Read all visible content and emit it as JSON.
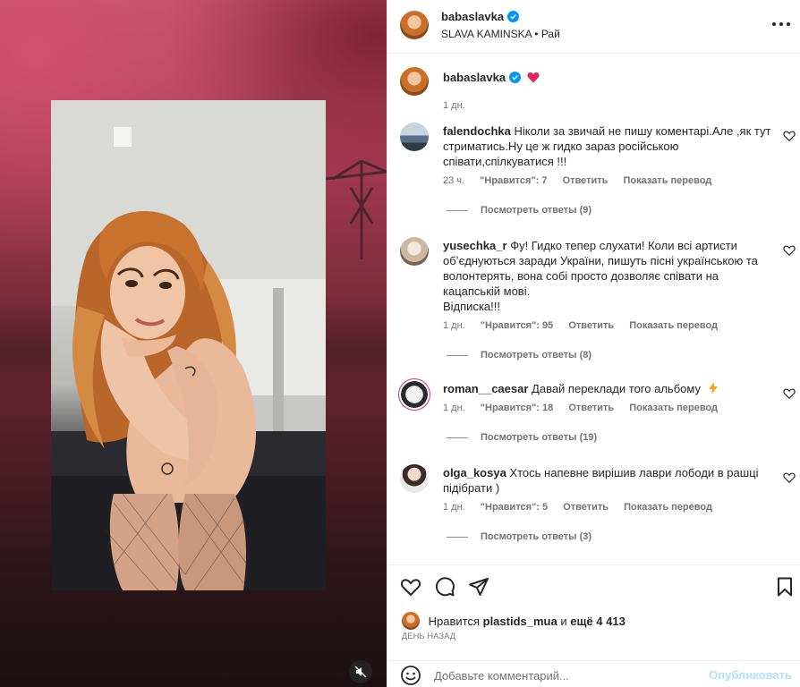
{
  "post_author": {
    "username": "babaslavka",
    "subtitle_name": "SLAVA KAMINSKA",
    "subtitle_separator": "•",
    "subtitle_audio": "Рай"
  },
  "caption": {
    "username": "babaslavka",
    "time": "1 дн."
  },
  "comments": [
    {
      "username": "falendochka",
      "text": "Ніколи за звичай не пишу коментарі.Але ,як тут стриматись.Ну це ж гидко зараз російською співати,спілкуватися !!!",
      "time": "23 ч.",
      "likes": "\"Нравится\": 7",
      "reply": "Ответить",
      "translate": "Показать перевод",
      "view_replies": "Посмотреть ответы (9)"
    },
    {
      "username": "yusechka_r",
      "text": "Фу! Гидко тепер слухати! Коли всі артисти обʼєднуються заради України, пишуть пісні українською та волонтерять, вона собі просто дозволяє співати на кацапській мові.",
      "text_line2": "Відписка!!!",
      "time": "1 дн.",
      "likes": "\"Нравится\": 95",
      "reply": "Ответить",
      "translate": "Показать перевод",
      "view_replies": "Посмотреть ответы (8)"
    },
    {
      "username": "roman__caesar",
      "text": "Давай переклади того альбому",
      "time": "1 дн.",
      "likes": "\"Нравится\": 18",
      "reply": "Ответить",
      "translate": "Показать перевод",
      "view_replies": "Посмотреть ответы (19)"
    },
    {
      "username": "olga_kosya",
      "text": "Хтось напевне вирішив лаври лободи в рашці підібрати )",
      "time": "1 дн.",
      "likes": "\"Нравится\": 5",
      "reply": "Ответить",
      "translate": "Показать перевод",
      "view_replies": "Посмотреть ответы (3)"
    }
  ],
  "likes_line": {
    "prefix": "Нравится",
    "user": "plastids_mua",
    "middle": "и",
    "rest": "ещё 4 413"
  },
  "date": "ДЕНЬ НАЗАД",
  "add_comment": {
    "placeholder": "Добавьте комментарий...",
    "post_label": "Опубликовать"
  },
  "icons": {
    "header_more": "more-horizontal-icon",
    "verified": "verified-badge-icon",
    "caption_heart": "red-heart-emoji-icon",
    "comment_like": "heart-outline-icon",
    "lightning": "high-voltage-emoji-icon",
    "like": "heart-outline-icon",
    "comment": "comment-bubble-icon",
    "share": "paper-plane-icon",
    "save": "bookmark-icon",
    "emoji": "smiley-icon",
    "mute": "speaker-muted-icon"
  },
  "colors": {
    "verified_blue": "#0095f6",
    "heart_red": "#e0245e",
    "post_button_disabled": "#b2dffc",
    "secondary_text": "#737373"
  }
}
